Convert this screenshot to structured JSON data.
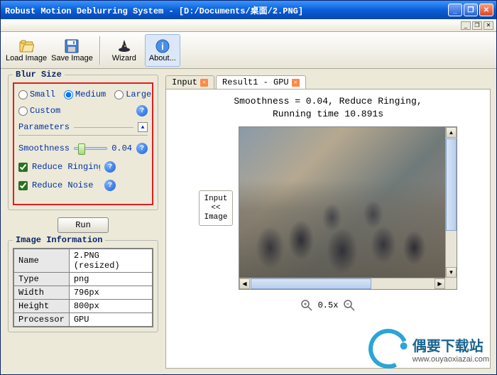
{
  "window": {
    "title": "Robust Motion Deblurring System - [D:/Documents/桌面/2.PNG]"
  },
  "toolbar": {
    "load": "Load Image",
    "save": "Save Image",
    "wizard": "Wizard",
    "about": "About..."
  },
  "blur_size": {
    "legend": "Blur Size",
    "small": "Small",
    "medium": "Medium",
    "large": "Large",
    "custom": "Custom",
    "selected": "medium"
  },
  "parameters": {
    "legend": "Parameters",
    "smoothness_label": "Smoothness",
    "smoothness_value": "0.04",
    "reduce_ringing": "Reduce Ringing",
    "reduce_noise": "Reduce Noise"
  },
  "run_button": "Run",
  "image_info": {
    "legend": "Image Information",
    "rows": {
      "name_k": "Name",
      "name_v": "2.PNG (resized)",
      "type_k": "Type",
      "type_v": "png",
      "width_k": "Width",
      "width_v": "796px",
      "height_k": "Height",
      "height_v": "800px",
      "proc_k": "Processor",
      "proc_v": "GPU"
    }
  },
  "tabs": {
    "input": "Input",
    "result": "Result1 - GPU"
  },
  "result": {
    "line1": "Smoothness = 0.04, Reduce Ringing,",
    "line2": "Running time 10.891s",
    "input_btn_l1": "Input",
    "input_btn_l2": "<< Image",
    "zoom": "0.5x"
  },
  "watermark": {
    "cn": "偶要下载站",
    "url": "www.ouyaoxiazai.com"
  }
}
